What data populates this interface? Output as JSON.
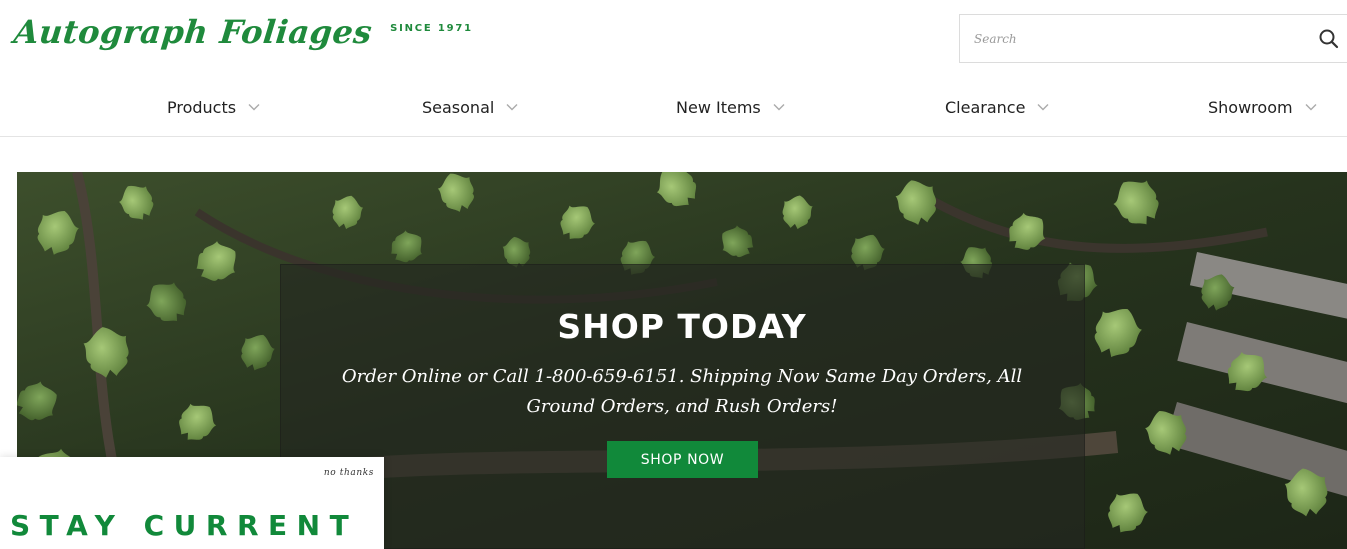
{
  "header": {
    "logo_text": "Autograph Foliages",
    "logo_tagline": "SINCE 1971",
    "brand_color": "#1f8a3c"
  },
  "search": {
    "placeholder": "Search",
    "icon": "search-icon"
  },
  "nav": {
    "items": [
      {
        "label": "Products",
        "icon": "chevron-down-icon"
      },
      {
        "label": "Seasonal",
        "icon": "chevron-down-icon"
      },
      {
        "label": "New Items",
        "icon": "chevron-down-icon"
      },
      {
        "label": "Clearance",
        "icon": "chevron-down-icon"
      },
      {
        "label": "Showroom",
        "icon": "chevron-down-icon"
      }
    ]
  },
  "hero": {
    "title": "SHOP TODAY",
    "subtitle": "Order Online or Call 1-800-659-6151. Shipping Now Same Day Orders, All Ground Orders, and Rush Orders!",
    "button_label": "SHOP NOW",
    "button_color": "#11893a"
  },
  "popup": {
    "close_label": "no thanks",
    "title": "STAY CURRENT"
  }
}
